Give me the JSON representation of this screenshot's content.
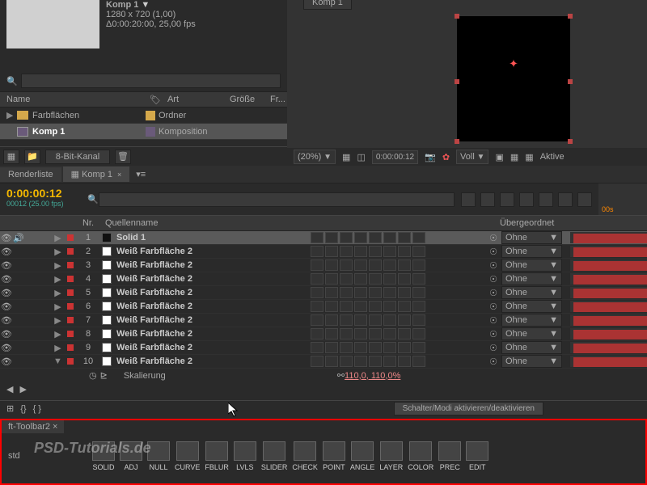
{
  "comp": {
    "name": "Komp 1",
    "dims": "1280 x 720 (1,00)",
    "dur": "Δ0:00:20:00, 25,00 fps",
    "tab": "Komp 1"
  },
  "project": {
    "headers": {
      "name": "Name",
      "art": "Art",
      "size": "Größe",
      "fr": "Fr..."
    },
    "rows": [
      {
        "name": "Farbflächen",
        "art": "Ordner",
        "type": "folder"
      },
      {
        "name": "Komp 1",
        "art": "Komposition",
        "type": "comp",
        "sel": true
      }
    ],
    "bits": "8-Bit-Kanal"
  },
  "viewer": {
    "zoom": "(20%)",
    "time": "0:00:00:12",
    "view": "Voll",
    "active": "Aktive"
  },
  "tabs": {
    "renderlist": "Renderliste",
    "comp": "Komp 1"
  },
  "timeline": {
    "timecode": "0:00:00:12",
    "fps": "00012 (25.00 fps)",
    "ruler": "00s",
    "headers": {
      "nr": "Nr.",
      "source": "Quellenname",
      "parent": "Übergeordnet"
    },
    "parent_none": "Ohne",
    "layers": [
      {
        "nr": "1",
        "name": "Solid 1",
        "color": "black",
        "sel": true
      },
      {
        "nr": "2",
        "name": "Weiß Farbfläche 2",
        "color": "white"
      },
      {
        "nr": "3",
        "name": "Weiß Farbfläche 2",
        "color": "white"
      },
      {
        "nr": "4",
        "name": "Weiß Farbfläche 2",
        "color": "white"
      },
      {
        "nr": "5",
        "name": "Weiß Farbfläche 2",
        "color": "white"
      },
      {
        "nr": "6",
        "name": "Weiß Farbfläche 2",
        "color": "white"
      },
      {
        "nr": "7",
        "name": "Weiß Farbfläche 2",
        "color": "white"
      },
      {
        "nr": "8",
        "name": "Weiß Farbfläche 2",
        "color": "white"
      },
      {
        "nr": "9",
        "name": "Weiß Farbfläche 2",
        "color": "white"
      },
      {
        "nr": "10",
        "name": "Weiß Farbfläche 2",
        "color": "white",
        "expanded": true
      }
    ],
    "prop": {
      "name": "Skalierung",
      "value": "110,0, 110,0%"
    },
    "toggle": "Schalter/Modi aktivieren/deaktivieren"
  },
  "toolbar": {
    "tab": "ft-Toolbar2",
    "std": "std",
    "buttons": [
      "SOLID",
      "ADJ",
      "NULL",
      "CURVE",
      "FBLUR",
      "LVLS",
      "SLIDER",
      "CHECK",
      "POINT",
      "ANGLE",
      "LAYER",
      "COLOR",
      "PREC",
      "EDIT"
    ]
  },
  "watermark": "PSD-Tutorials.de"
}
